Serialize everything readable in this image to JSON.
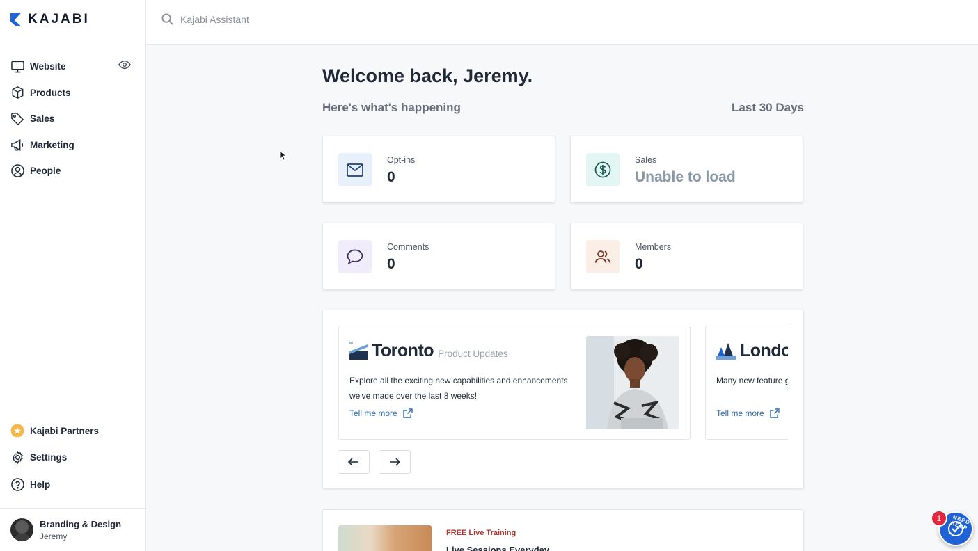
{
  "brand": {
    "name": "KAJABI",
    "accent": "#1f62d6"
  },
  "search": {
    "placeholder": "Kajabi Assistant"
  },
  "sidebar": {
    "items": [
      {
        "label": "Website",
        "icon": "monitor-icon"
      },
      {
        "label": "Products",
        "icon": "box-icon"
      },
      {
        "label": "Sales",
        "icon": "tag-icon"
      },
      {
        "label": "Marketing",
        "icon": "megaphone-icon"
      },
      {
        "label": "People",
        "icon": "user-circle-icon"
      }
    ],
    "bottom": [
      {
        "label": "Kajabi Partners",
        "icon": "star-badge-icon"
      },
      {
        "label": "Settings",
        "icon": "gear-icon"
      },
      {
        "label": "Help",
        "icon": "question-icon"
      }
    ],
    "user": {
      "site": "Branding & Design",
      "name": "Jeremy"
    }
  },
  "main": {
    "title": "Welcome back, Jeremy.",
    "subtitle": "Here's what's happening",
    "range": "Last 30 Days",
    "stats": [
      {
        "label": "Opt-ins",
        "value": "0",
        "color": "#e7f0fb"
      },
      {
        "label": "Sales",
        "value": "Unable to load",
        "color": "#e3f6f4"
      },
      {
        "label": "Comments",
        "value": "0",
        "color": "#f1ecfa"
      },
      {
        "label": "Members",
        "value": "0",
        "color": "#fbeee6"
      }
    ],
    "promos": [
      {
        "city": "Toronto",
        "tag": "Product Updates",
        "desc": "Explore all the exciting new capabilities and enhancements we've made over the last 8 weeks!",
        "link": "Tell me more"
      },
      {
        "city": "Londo",
        "desc": "Many new feature greater flexibility a",
        "link": "Tell me more"
      }
    ],
    "training": {
      "kicker": "FREE Live Training",
      "head": "Live Sessions Everyday"
    }
  },
  "help": {
    "badge": "1",
    "label": "NEED HELP"
  }
}
